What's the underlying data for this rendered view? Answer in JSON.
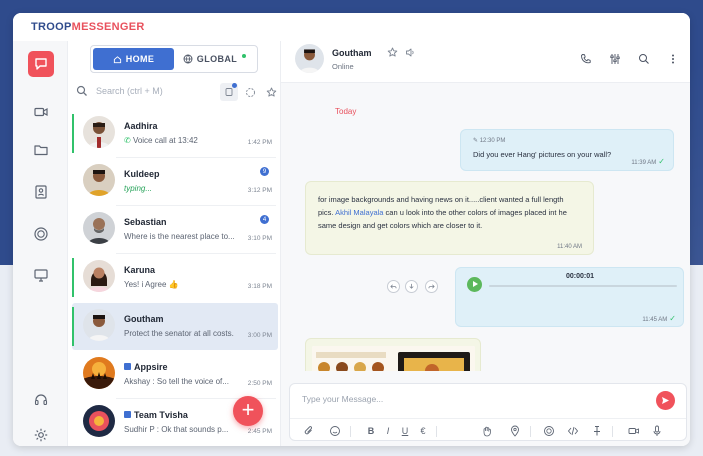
{
  "app": {
    "logo_part1": "TROOP",
    "logo_part2": "MESSENGER"
  },
  "colors": {
    "brand_blue": "#2f4b8c",
    "accent_red": "#f0525b",
    "online_green": "#31c26b",
    "tab_blue": "#3f6fd1"
  },
  "rail": {
    "items": [
      {
        "icon": "chat-icon",
        "active": true
      },
      {
        "icon": "video-icon",
        "active": false
      },
      {
        "icon": "folder-icon",
        "active": false
      },
      {
        "icon": "contacts-icon",
        "active": false
      },
      {
        "icon": "channel-icon",
        "active": false
      },
      {
        "icon": "screen-icon",
        "active": false
      },
      {
        "icon": "headset-icon",
        "active": false
      },
      {
        "icon": "settings-icon",
        "active": false
      }
    ]
  },
  "panel": {
    "tabs": [
      {
        "label": "HOME",
        "icon": "home-icon"
      },
      {
        "label": "GLOBAL",
        "icon": "globe-icon"
      }
    ],
    "search_placeholder": "Search  (ctrl + M)",
    "contacts": [
      {
        "name": "Aadhira",
        "sub": "Voice call at 13:42",
        "time": "1:42 PM",
        "avatar": "person"
      },
      {
        "name": "Kuldeep",
        "sub": "typing...",
        "time": "3:12 PM",
        "badge": "9",
        "avatar": "person"
      },
      {
        "name": "Sebastian",
        "sub": "Where is the nearest place to...",
        "time": "3:10 PM",
        "badge": "4",
        "avatar": "person"
      },
      {
        "name": "Karuna",
        "sub": "Yes! i Agree 👍",
        "time": "3:18 PM",
        "avatar": "person"
      },
      {
        "name": "Goutham",
        "sub": "Protect the senator at all costs.",
        "time": "3:00 PM",
        "avatar": "person"
      },
      {
        "name": "Appsire",
        "sub": "Akshay : So tell the voice of...",
        "time": "2:50 PM",
        "avatar": "group"
      },
      {
        "name": "Team Tvisha",
        "sub": "Sudhir P : Ok that sounds p...",
        "time": "2:45 PM",
        "avatar": "group"
      }
    ]
  },
  "chat": {
    "name": "Goutham",
    "status": "Online",
    "date_divider": "Today",
    "messages": [
      {
        "direction": "out",
        "edited_time": "12:30 PM",
        "text": "Did you ever Hang' pictures on your wall?",
        "time": "11:39 AM"
      },
      {
        "direction": "in",
        "text_before": "for image backgrounds and having news on it.....client wanted a full length pics. ",
        "mention": "Akhil Malayala",
        "text_after": " can u look into the other colors of images placed int he same design and get colors which are closer to it.",
        "time": "11:40 AM"
      },
      {
        "direction": "out",
        "type": "audio",
        "duration": "00:00:01",
        "time": "11:45 AM"
      }
    ],
    "composer_placeholder": "Type your Message...",
    "format_bold": "B",
    "format_italic": "I",
    "format_underline": "U",
    "format_strike": "€"
  }
}
